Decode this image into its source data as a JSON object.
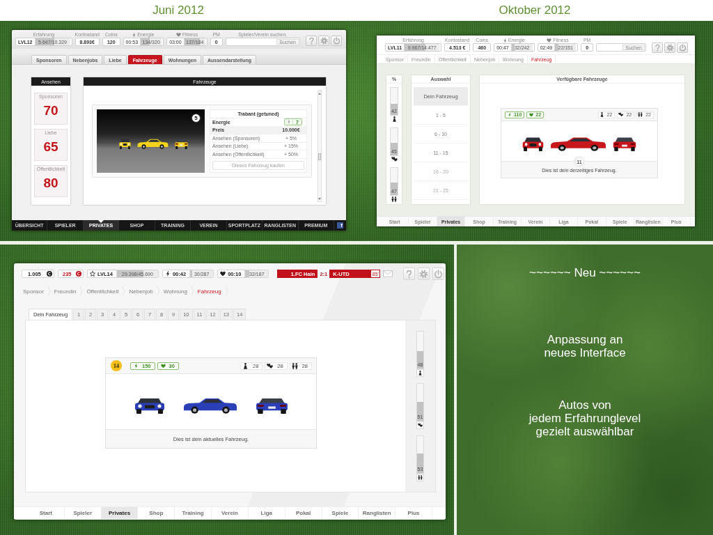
{
  "juni_2012_screen": {
    "caption": "Juni 2012",
    "stats": [
      {
        "kind": "xp",
        "label": "Erfahrung",
        "badge": "LVL12",
        "value": "5.647/10.329",
        "level": 0.55
      },
      {
        "kind": "value",
        "label": "Kontostand",
        "value": "8.893€"
      },
      {
        "kind": "value",
        "label": "Coins",
        "value": "120"
      },
      {
        "kind": "energy",
        "label": "Energie",
        "time": "00:53",
        "value": "134/320",
        "level": 0.42
      },
      {
        "kind": "fitness",
        "label": "Fitness",
        "time": "03:00",
        "value": "137/184",
        "level": 0.74
      },
      {
        "kind": "value",
        "label": "PM",
        "value": "0"
      },
      {
        "kind": "search",
        "label": "Spieler/Verein suchen.",
        "button": "Suchen"
      }
    ],
    "tabs": [
      {
        "label": "Sponsoren",
        "selected": false
      },
      {
        "label": "Nebenjobs",
        "selected": false
      },
      {
        "label": "Liebe",
        "selected": false
      },
      {
        "label": "Fahrzeuge",
        "selected": true
      },
      {
        "label": "Wohnungen",
        "selected": false
      },
      {
        "label": "Aussendarstellung",
        "selected": false
      }
    ],
    "reputation": {
      "title": "Ansehen",
      "items": [
        {
          "label": "Sponsoren",
          "value": "70"
        },
        {
          "label": "Liebe",
          "value": "65"
        },
        {
          "label": "Öffentlichkeit",
          "value": "80"
        }
      ]
    },
    "vehicles": {
      "title": "Fahrzeuge",
      "level": "5",
      "name": "Trabant (getuned)",
      "rows": [
        {
          "kind": "energy",
          "label": "Energie",
          "value": "7"
        },
        {
          "kind": "price",
          "label": "Preis",
          "value": "10.000€"
        },
        {
          "kind": "bonus",
          "label": "Ansehen (Sponsoren)",
          "value": "+ 5%"
        },
        {
          "kind": "bonus",
          "label": "Ansehen (Liebe)",
          "value": "+ 15%"
        },
        {
          "kind": "bonus",
          "label": "Ansehen (Öffentlichkeit)",
          "value": "+ 50%"
        }
      ],
      "buy_button": {
        "label": "Dieses Fahrzeug kaufen",
        "disabled": true
      }
    },
    "nav": [
      {
        "label": "ÜBERSICHT",
        "selected": false
      },
      {
        "label": "SPIELER",
        "selected": false
      },
      {
        "label": "PRIVATES",
        "selected": true
      },
      {
        "label": "SHOP",
        "selected": false
      },
      {
        "label": "TRAINING",
        "selected": false
      },
      {
        "label": "VEREIN",
        "selected": false
      },
      {
        "label": "SPORTPLATZ",
        "selected": false
      },
      {
        "label": "RANGLISTEN",
        "selected": false
      },
      {
        "label": "PREMIUM",
        "selected": false
      }
    ],
    "social_link": "f"
  },
  "oktober_2012_screen": {
    "caption": "Oktober 2012",
    "stats": [
      {
        "kind": "xp",
        "label": "Erfahrung",
        "badge": "LVL11",
        "value": "9.967/14.477",
        "level": 0.6
      },
      {
        "kind": "value",
        "label": "Kontostand",
        "value": "4.513 €"
      },
      {
        "kind": "value",
        "label": "Coins",
        "value": "460"
      },
      {
        "kind": "energy",
        "label": "Energie",
        "time": "00:47",
        "value": "32/242",
        "level": 0.13
      },
      {
        "kind": "fitness",
        "label": "Fitness",
        "time": "02:49",
        "value": "22/151",
        "level": 0.15
      },
      {
        "kind": "value",
        "label": "PM",
        "value": "0"
      },
      {
        "kind": "search",
        "button": "Suchen"
      }
    ],
    "subnav": [
      {
        "label": "Sponsor",
        "selected": false
      },
      {
        "label": "Freundin",
        "selected": false
      },
      {
        "label": "Öffentlichkeit",
        "selected": false
      },
      {
        "label": "Nebenjob",
        "selected": false
      },
      {
        "label": "Wohnung",
        "selected": false
      },
      {
        "label": "Fahrzeug",
        "selected": true
      }
    ],
    "percent": {
      "title": "%",
      "bars": [
        {
          "kind": "sponsor",
          "value": "42",
          "level": 0.42
        },
        {
          "kind": "love",
          "value": "45",
          "level": 0.45
        },
        {
          "kind": "public",
          "value": "47",
          "level": 0.47
        }
      ]
    },
    "selection": {
      "title": "Auswahl",
      "items": [
        {
          "label": "Dein Fahrzeug",
          "selected": true,
          "disabled": false
        },
        {
          "label": "1 - 5",
          "selected": false,
          "disabled": false
        },
        {
          "label": "6 - 10",
          "selected": false,
          "disabled": false
        },
        {
          "label": "11 - 15",
          "selected": false,
          "disabled": false
        },
        {
          "label": "16 - 20",
          "selected": false,
          "disabled": true
        },
        {
          "label": "21 - 25",
          "selected": false,
          "disabled": true
        }
      ]
    },
    "available": {
      "title": "Verfügbare Fahrzeuge",
      "boosts": [
        {
          "kind": "energy",
          "value": "110"
        },
        {
          "kind": "fitness",
          "value": "22"
        }
      ],
      "ratings": [
        {
          "kind": "sponsor",
          "value": "22"
        },
        {
          "kind": "love",
          "value": "22"
        },
        {
          "kind": "public",
          "value": "22"
        }
      ],
      "level": "11",
      "caption": "Dies ist dein derzeitiges Fahrzeug."
    },
    "nav": [
      {
        "label": "Start",
        "selected": false
      },
      {
        "label": "Spieler",
        "selected": false
      },
      {
        "label": "Privates",
        "selected": true
      },
      {
        "label": "Shop",
        "selected": false
      },
      {
        "label": "Training",
        "selected": false
      },
      {
        "label": "Verein",
        "selected": false
      },
      {
        "label": "Liga",
        "selected": false
      },
      {
        "label": "Pokal",
        "selected": false
      },
      {
        "label": "Spiele",
        "selected": false
      },
      {
        "label": "Ranglisten",
        "selected": false
      },
      {
        "label": "Plus",
        "selected": false
      }
    ]
  },
  "new_screen": {
    "status": [
      {
        "kind": "balance",
        "value": "1.005"
      },
      {
        "kind": "coins",
        "value": "235"
      },
      {
        "kind": "xp",
        "badge": "LVL14",
        "value": "29.398/45.690",
        "level": 0.64
      },
      {
        "kind": "energy",
        "time": "00:42",
        "value": "30/287",
        "level": 0.1
      },
      {
        "kind": "fitness",
        "time": "00:10",
        "value": "32/187",
        "level": 0.17
      }
    ],
    "match": {
      "home": "1.FC Hain",
      "score": "2:1",
      "away": "K-UTD",
      "minute": "85'"
    },
    "breadcrumb": [
      {
        "label": "Sponsor",
        "selected": false
      },
      {
        "label": "Freundin",
        "selected": false
      },
      {
        "label": "Öffentlichkeit",
        "selected": false
      },
      {
        "label": "Nebenjob",
        "selected": false
      },
      {
        "label": "Wohnung",
        "selected": false
      },
      {
        "label": "Fahrzeug",
        "selected": true
      }
    ],
    "tabs": [
      {
        "label": "Dein Fahrzeug",
        "selected": true
      },
      {
        "label": "1",
        "selected": false
      },
      {
        "label": "2",
        "selected": false
      },
      {
        "label": "3",
        "selected": false
      },
      {
        "label": "4",
        "selected": false
      },
      {
        "label": "5",
        "selected": false
      },
      {
        "label": "6",
        "selected": false
      },
      {
        "label": "7",
        "selected": false
      },
      {
        "label": "8",
        "selected": false
      },
      {
        "label": "9",
        "selected": false
      },
      {
        "label": "10",
        "selected": false
      },
      {
        "label": "11",
        "selected": false
      },
      {
        "label": "12",
        "selected": false
      },
      {
        "label": "13",
        "selected": false
      },
      {
        "label": "14",
        "selected": false
      }
    ],
    "vehicle": {
      "level": "14",
      "boosts": [
        {
          "kind": "energy",
          "value": "150"
        },
        {
          "kind": "fitness",
          "value": "30"
        }
      ],
      "ratings": [
        {
          "kind": "sponsor",
          "value": "28"
        },
        {
          "kind": "love",
          "value": "28"
        },
        {
          "kind": "public",
          "value": "28"
        }
      ],
      "caption": "Dies ist dein aktuelles Fahrzeug."
    },
    "percent_bars": [
      {
        "kind": "sponsor",
        "value": "48",
        "level": 0.48
      },
      {
        "kind": "love",
        "value": "51",
        "level": 0.51
      },
      {
        "kind": "public",
        "value": "53",
        "level": 0.53
      }
    ],
    "nav": [
      {
        "label": "Start",
        "selected": false
      },
      {
        "label": "Spieler",
        "selected": false
      },
      {
        "label": "Privates",
        "selected": true
      },
      {
        "label": "Shop",
        "selected": false
      },
      {
        "label": "Training",
        "selected": false
      },
      {
        "label": "Verein",
        "selected": false
      },
      {
        "label": "Liga",
        "selected": false
      },
      {
        "label": "Pokal",
        "selected": false
      },
      {
        "label": "Spiele",
        "selected": false
      },
      {
        "label": "Ranglisten",
        "selected": false
      },
      {
        "label": "Plus",
        "selected": false
      }
    ]
  },
  "notes": {
    "heading": "~~~~~~ Neu ~~~~~~",
    "points": [
      "Anpassung an\nneues Interface",
      "Autos von\njedem Erfahrunglevel\ngezielt auswählbar"
    ]
  }
}
